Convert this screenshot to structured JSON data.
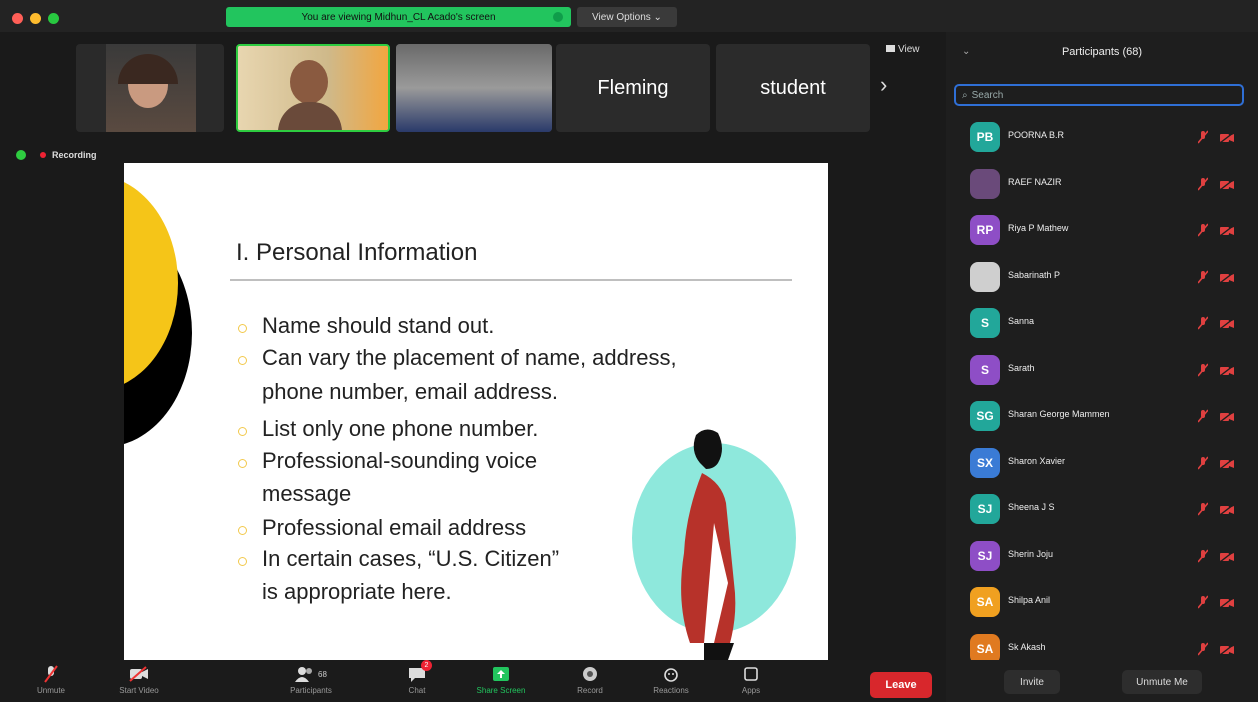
{
  "titlebar": {
    "banner_text": "You are viewing Midhun_CL Acado's screen",
    "view_options": "View Options ⌄"
  },
  "thumbnails": {
    "tiles": [
      {
        "label": ""
      },
      {
        "label": ""
      },
      {
        "label": ""
      },
      {
        "label": "Fleming"
      },
      {
        "label": "student"
      }
    ],
    "next_arrow": "›",
    "view_label": "View"
  },
  "recording": {
    "label": "Recording"
  },
  "slide": {
    "title": "I. Personal Information",
    "lines": [
      "Name should stand out.",
      "Can vary the placement of name, address,",
      "phone number, email address.",
      "List only one phone number.",
      "Professional-sounding voice",
      "message",
      "Professional email address",
      "In certain cases, “U.S. Citizen”",
      "is appropriate here."
    ]
  },
  "participants": {
    "title": "Participants (68)",
    "search_placeholder": "Search",
    "list": [
      {
        "initials": "PB",
        "name": "POORNA B.R",
        "color": "#22a79a"
      },
      {
        "initials": "",
        "name": "RAEF NAZIR",
        "color": "#6a4a7a"
      },
      {
        "initials": "RP",
        "name": "Riya P Mathew",
        "color": "#8e4ec6"
      },
      {
        "initials": "",
        "name": "Sabarinath P",
        "color": "#cfcfcf"
      },
      {
        "initials": "S",
        "name": "Sanna",
        "color": "#22a79a"
      },
      {
        "initials": "S",
        "name": "Sarath",
        "color": "#8e4ec6"
      },
      {
        "initials": "SG",
        "name": "Sharan George Mammen",
        "color": "#22a79a"
      },
      {
        "initials": "SX",
        "name": "Sharon Xavier",
        "color": "#3a7bd5"
      },
      {
        "initials": "SJ",
        "name": "Sheena J S",
        "color": "#22a79a"
      },
      {
        "initials": "SJ",
        "name": "Sherin Joju",
        "color": "#8e4ec6"
      },
      {
        "initials": "SA",
        "name": "Shilpa Anil",
        "color": "#f0a020"
      },
      {
        "initials": "SA",
        "name": "Sk Akash",
        "color": "#e07a20"
      }
    ],
    "invite": "Invite",
    "unmute_me": "Unmute Me"
  },
  "toolbar": {
    "unmute": "Unmute",
    "start_video": "Start Video",
    "participants": "Participants",
    "participants_count": "68",
    "chat": "Chat",
    "chat_badge": "2",
    "share_screen": "Share Screen",
    "record": "Record",
    "reactions": "Reactions",
    "apps": "Apps",
    "leave": "Leave"
  },
  "colors": {
    "accent_green": "#22c55e",
    "leave_red": "#d8272c",
    "search_border": "#2f6fd6",
    "slide_yellow": "#f5c518",
    "slide_teal": "#8ee8dc"
  }
}
